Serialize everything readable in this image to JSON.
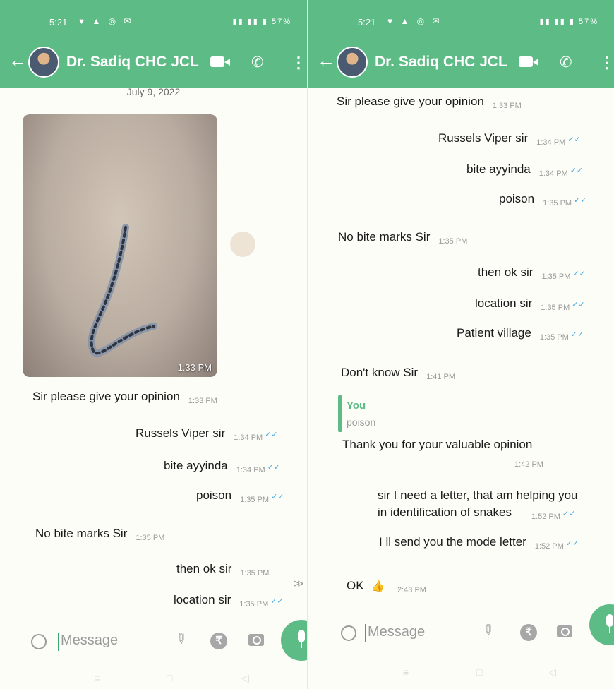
{
  "status_bar": {
    "time": "5:21",
    "battery": "57%"
  },
  "chat": {
    "contact_name": "Dr. Sadiq CHC JCL"
  },
  "composer": {
    "placeholder": "Message"
  },
  "left": {
    "date_separator": "July 9, 2022",
    "photo_time": "1:33 PM",
    "messages": [
      {
        "text": "Sir please give your opinion",
        "time": "1:33 PM"
      },
      {
        "text": "Russels Viper sir",
        "time": "1:34 PM"
      },
      {
        "text": "bite ayyinda",
        "time": "1:34 PM"
      },
      {
        "text": "poison",
        "time": "1:35 PM"
      },
      {
        "text": "No bite marks Sir",
        "time": "1:35 PM"
      },
      {
        "text": "then ok sir",
        "time": "1:35 PM"
      },
      {
        "text": "location sir",
        "time": "1:35 PM"
      }
    ]
  },
  "right": {
    "messages": [
      {
        "text": "Sir please give your opinion",
        "time": "1:33 PM"
      },
      {
        "text": "Russels Viper sir",
        "time": "1:34 PM"
      },
      {
        "text": "bite ayyinda",
        "time": "1:34 PM"
      },
      {
        "text": "poison",
        "time": "1:35 PM"
      },
      {
        "text": "No bite marks Sir",
        "time": "1:35 PM"
      },
      {
        "text": "then ok sir",
        "time": "1:35 PM"
      },
      {
        "text": "location sir",
        "time": "1:35 PM"
      },
      {
        "text": "Patient village",
        "time": "1:35 PM"
      },
      {
        "text": "Don't know Sir",
        "time": "1:41 PM"
      },
      {
        "reply_to_name": "You",
        "reply_to_text": "poison",
        "text": "Thank you for your valuable opinion",
        "time": "1:42 PM"
      },
      {
        "text_line1": "sir I need a letter, that am helping you",
        "text_line2": "in identification of snakes",
        "time": "1:52 PM"
      },
      {
        "text": "I ll send you the mode letter",
        "time": "1:52 PM"
      },
      {
        "text": "OK",
        "time": "2:43 PM"
      }
    ]
  },
  "colors": {
    "accent": "#5dbb86",
    "tick": "#4aa9de",
    "timestamp": "#9a9a9a"
  },
  "icons": [
    "back-arrow-icon",
    "video-call-icon",
    "phone-icon",
    "more-options-icon",
    "emoji-icon",
    "attach-icon",
    "rupee-icon",
    "camera-icon",
    "mic-icon",
    "double-tick-icon",
    "thumbs-up-emoji",
    "scroll-down-icon"
  ]
}
